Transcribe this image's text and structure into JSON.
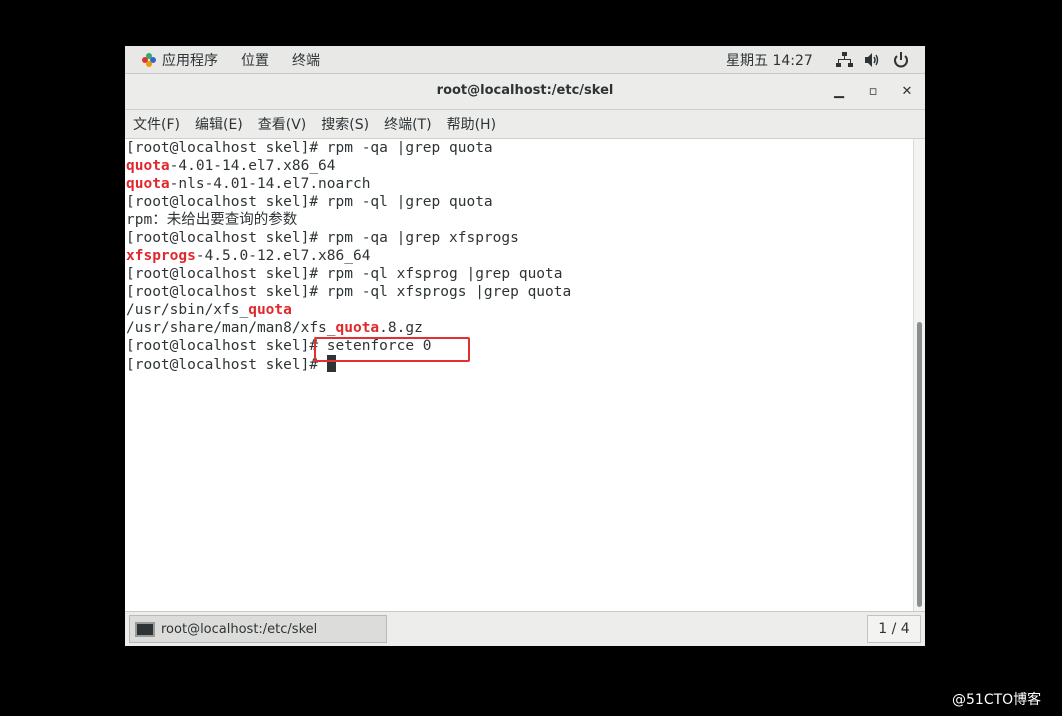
{
  "topbar": {
    "apps_label": "应用程序",
    "places_label": "位置",
    "terminal_label": "终端",
    "clock": "星期五 14:27"
  },
  "window": {
    "title": "root@localhost:/etc/skel",
    "minimize": "▁",
    "maximize": "▫",
    "close": "✕"
  },
  "menubar": {
    "file": "文件(F)",
    "edit": "编辑(E)",
    "view": "查看(V)",
    "search": "搜索(S)",
    "terminal": "终端(T)",
    "help": "帮助(H)"
  },
  "terminal": {
    "lines": [
      [
        {
          "t": "[root@localhost skel]# rpm -qa |grep quota"
        }
      ],
      [
        {
          "t": "quota",
          "h": true
        },
        {
          "t": "-4.01-14.el7.x86_64"
        }
      ],
      [
        {
          "t": "quota",
          "h": true
        },
        {
          "t": "-nls-4.01-14.el7.noarch"
        }
      ],
      [
        {
          "t": "[root@localhost skel]# rpm -ql |grep quota"
        }
      ],
      [
        {
          "t": "rpm：未给出要查询的参数"
        }
      ],
      [
        {
          "t": "[root@localhost skel]# rpm -qa |grep xfsprogs"
        }
      ],
      [
        {
          "t": "xfsprogs",
          "h": true
        },
        {
          "t": "-4.5.0-12.el7.x86_64"
        }
      ],
      [
        {
          "t": "[root@localhost skel]# rpm -ql xfsprog |grep quota"
        }
      ],
      [
        {
          "t": "[root@localhost skel]# rpm -ql xfsprogs |grep quota"
        }
      ],
      [
        {
          "t": "/usr/sbin/xfs_"
        },
        {
          "t": "quota",
          "h": true
        }
      ],
      [
        {
          "t": "/usr/share/man/man8/xfs_"
        },
        {
          "t": "quota",
          "h": true
        },
        {
          "t": ".8.gz"
        }
      ],
      [
        {
          "t": "[root@localhost skel]# setenforce 0"
        }
      ],
      [
        {
          "t": "[root@localhost skel]# "
        }
      ]
    ]
  },
  "taskbar": {
    "task_label": "root@localhost:/etc/skel",
    "pager": "1 / 4"
  },
  "watermark": "@51CTO博客",
  "colors": {
    "highlight": "#e0282d",
    "annotation_box": "#e03030",
    "text": "#2e3436"
  }
}
